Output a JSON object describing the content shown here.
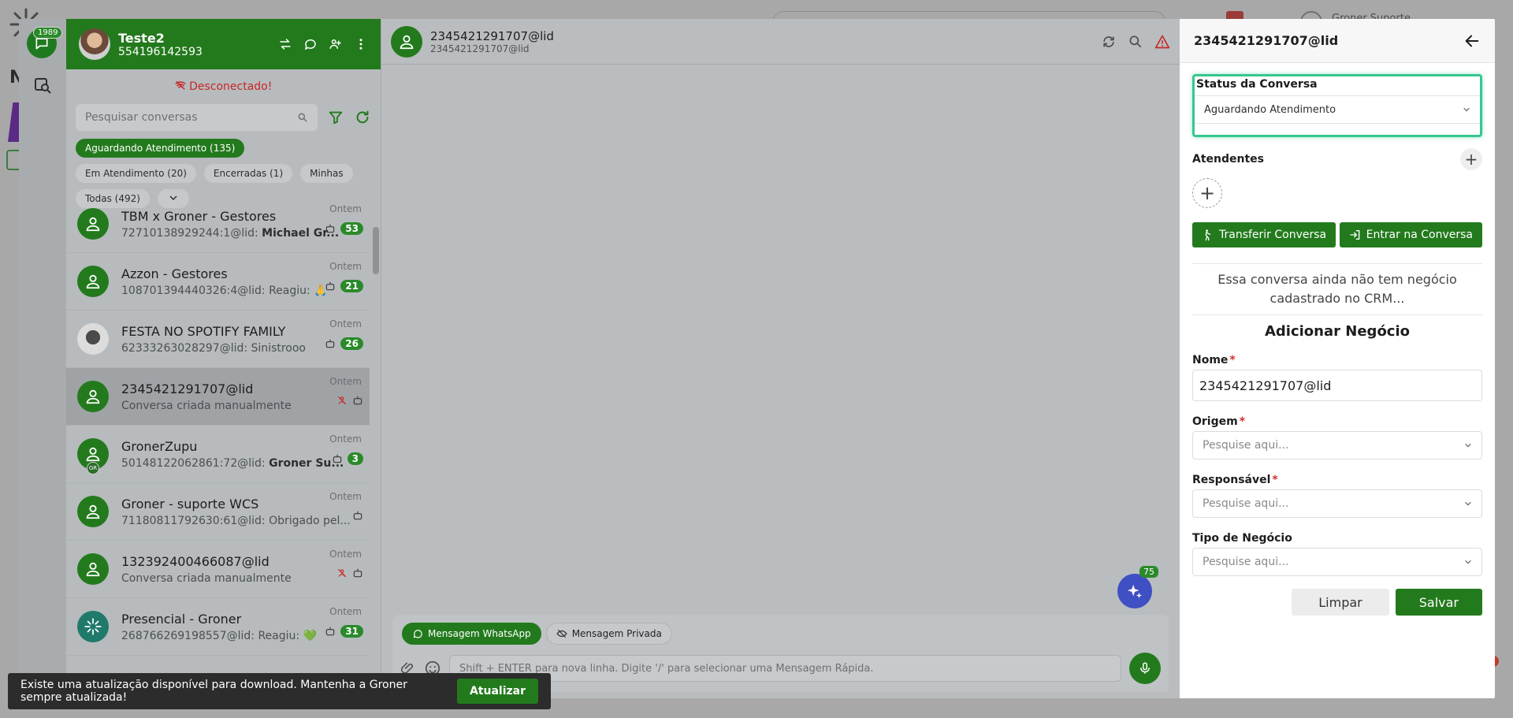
{
  "left_panel": {
    "rail_badge": "1989",
    "profile": {
      "name": "Teste2",
      "phone": "554196142593"
    },
    "status": "Desconectado!",
    "search_placeholder": "Pesquisar conversas",
    "filters": [
      {
        "label": "Aguardando Atendimento (135)",
        "active": true
      },
      {
        "label": "Em Atendimento (20)",
        "active": false
      },
      {
        "label": "Encerradas (1)",
        "active": false
      },
      {
        "label": "Minhas",
        "active": false
      },
      {
        "label": "Todas (492)",
        "active": false
      }
    ],
    "conversations": [
      {
        "name": "TBM x Groner - Gestores",
        "preview_prefix": "72710138929244:1@lid: ",
        "preview_bold": "Michael Gr...",
        "time": "Ontem",
        "count": "53",
        "avatar": "default"
      },
      {
        "name": "Azzon - Gestores",
        "preview_prefix": "108701394440326:4@lid: Reagiu: 🙏",
        "preview_bold": "",
        "time": "Ontem",
        "count": "21",
        "avatar": "default"
      },
      {
        "name": "FESTA NO SPOTIFY FAMILY",
        "preview_prefix": "62333263028297@lid: Sinistrooo",
        "preview_bold": "",
        "time": "Ontem",
        "count": "26",
        "avatar": "photo"
      },
      {
        "name": "2345421291707@lid",
        "preview_prefix": "Conversa criada manualmente",
        "preview_bold": "",
        "time": "Ontem",
        "count": "",
        "avatar": "default",
        "selected": true
      },
      {
        "name": "GronerZupu",
        "preview_prefix": "50148122062861:72@lid: ",
        "preview_bold": "Groner Su...",
        "time": "Ontem",
        "count": "3",
        "avatar": "default",
        "badge": "GR"
      },
      {
        "name": "Groner - suporte WCS",
        "preview_prefix": "71180811792630:61@lid: Obrigado pel...",
        "preview_bold": "",
        "time": "Ontem",
        "count": "",
        "avatar": "default"
      },
      {
        "name": "132392400466087@lid",
        "preview_prefix": "Conversa criada manualmente",
        "preview_bold": "",
        "time": "Ontem",
        "count": "",
        "avatar": "default"
      },
      {
        "name": "Presencial - Groner",
        "preview_prefix": "268766269198557@lid: Reagiu: 💚",
        "preview_bold": "",
        "time": "Ontem",
        "count": "31",
        "avatar": "teal"
      }
    ]
  },
  "chat": {
    "title": "2345421291707@lid",
    "subtitle": "2345421291707@lid",
    "ai_badge": "75",
    "tabs": [
      "Mensagem WhatsApp",
      "Mensagem Privada"
    ],
    "input_placeholder": "Shift + ENTER para nova linha. Digite '/' para selecionar uma Mensagem Rápida."
  },
  "details": {
    "title": "2345421291707@lid",
    "status_label": "Status da Conversa",
    "status_value": "Aguardando Atendimento",
    "attendants_label": "Atendentes",
    "transfer_button": "Transferir Conversa",
    "enter_button": "Entrar na Conversa",
    "crm_note": "Essa conversa ainda não tem negócio cadastrado no CRM...",
    "add_deal_title": "Adicionar Negócio",
    "fields": {
      "name_label": "Nome",
      "name_value": "2345421291707@lid",
      "origin_label": "Origem",
      "responsible_label": "Responsável",
      "deal_type_label": "Tipo de Negócio",
      "search_placeholder": "Pesquise aqui..."
    },
    "clear_button": "Limpar",
    "save_button": "Salvar"
  },
  "toast": {
    "message": "Existe uma atualização disponível para download. Mantenha a Groner sempre atualizada!",
    "button": "Atualizar"
  },
  "background": {
    "letter": "N",
    "user_text": "Groner Suporte"
  },
  "colors": {
    "brand_green": "#237a1d",
    "focus_teal": "#36c78e",
    "disconnected_red": "#c62828",
    "ai_blue": "#3f4fc4"
  }
}
